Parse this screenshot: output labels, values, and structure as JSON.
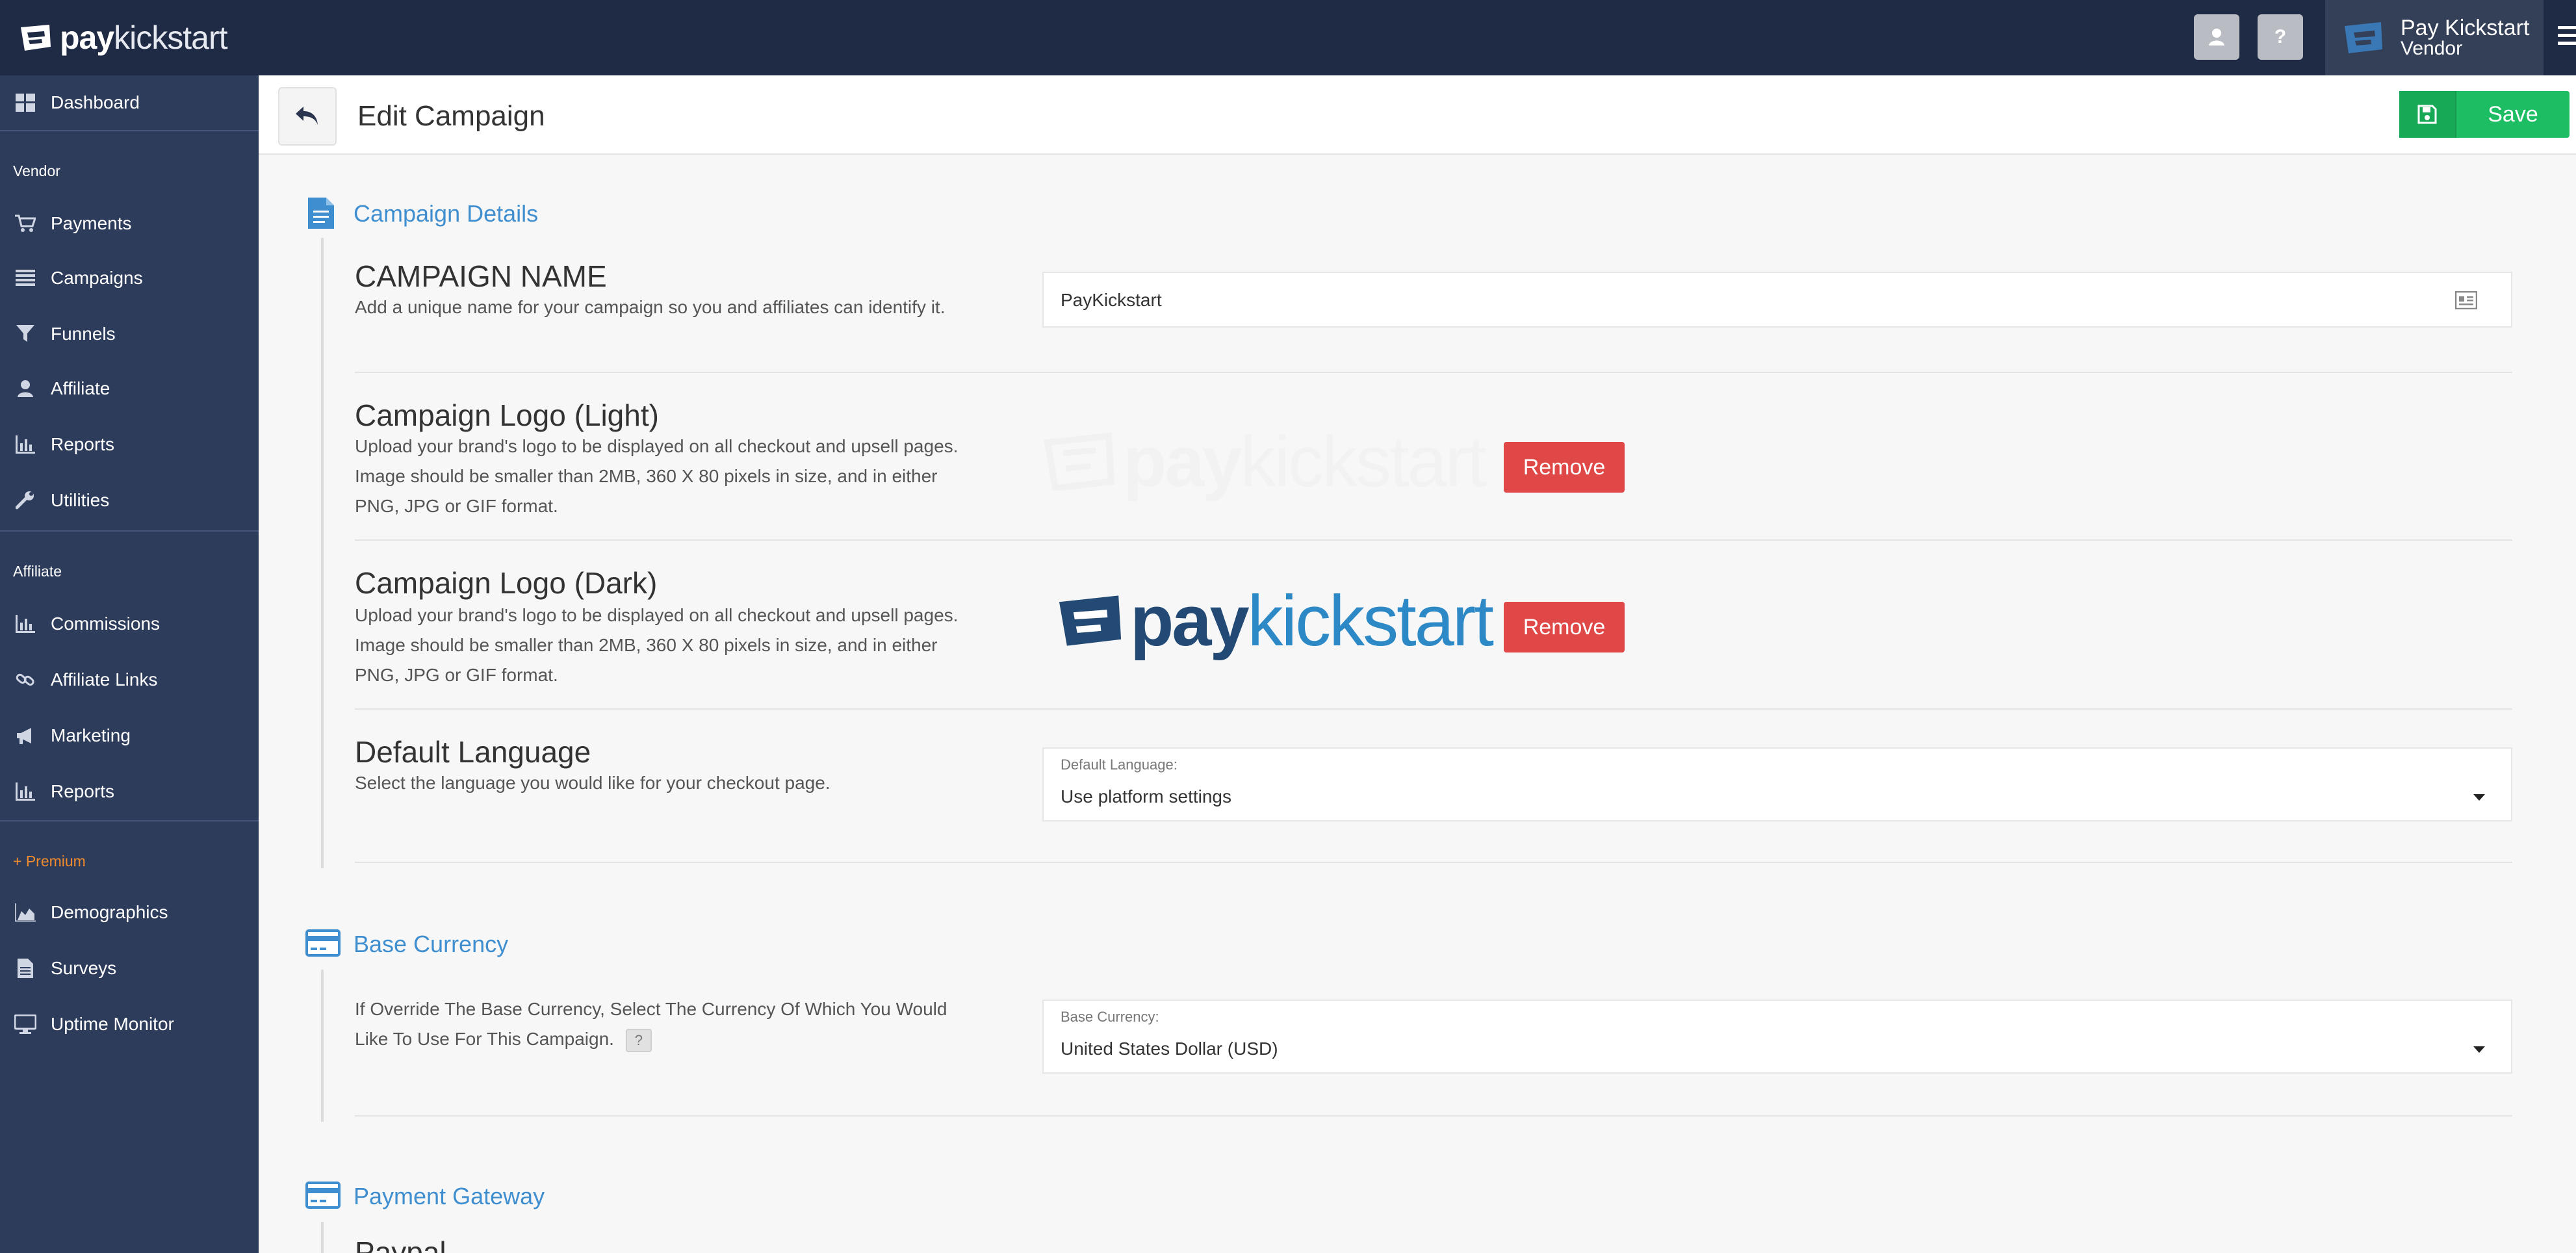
{
  "topbar": {
    "brand_bold": "pay",
    "brand_light": "kickstart",
    "user_button_label": "",
    "help_button_label": "?",
    "account_name": "Pay Kickstart",
    "account_role": "Vendor"
  },
  "sidebar": {
    "dashboard": "Dashboard",
    "vendor_heading": "Vendor",
    "vendor_items": [
      "Payments",
      "Campaigns",
      "Funnels",
      "Affiliate",
      "Reports",
      "Utilities"
    ],
    "affiliate_heading": "Affiliate",
    "affiliate_items": [
      "Commissions",
      "Affiliate Links",
      "Marketing",
      "Reports"
    ],
    "premium_heading": "+ Premium",
    "premium_items": [
      "Demographics",
      "Surveys",
      "Uptime Monitor"
    ]
  },
  "header": {
    "title": "Edit Campaign",
    "save_label": "Save"
  },
  "campaign_details": {
    "section_title": "Campaign Details",
    "name": {
      "title": "CAMPAIGN NAME",
      "description": "Add a unique name for your campaign so you and affiliates can identify it.",
      "value": "PayKickstart"
    },
    "logo_light": {
      "title": "Campaign Logo (Light)",
      "description": "Upload your brand's logo to be displayed on all checkout and upsell pages. Image should be smaller than 2MB, 360 X 80 pixels in size, and in either PNG, JPG or GIF format.",
      "remove_label": "Remove"
    },
    "logo_dark": {
      "title": "Campaign Logo (Dark)",
      "description": "Upload your brand's logo to be displayed on all checkout and upsell pages. Image should be smaller than 2MB, 360 X 80 pixels in size, and in either PNG, JPG or GIF format.",
      "remove_label": "Remove"
    },
    "language": {
      "title": "Default Language",
      "description": "Select the language you would like for your checkout page.",
      "field_label": "Default Language:",
      "value": "Use platform settings"
    }
  },
  "base_currency": {
    "section_title": "Base Currency",
    "description": "If Override The Base Currency, Select The Currency Of Which You Would Like To Use For This Campaign.",
    "help_label": "?",
    "field_label": "Base Currency:",
    "value": "United States Dollar (USD)"
  },
  "payment_gateway": {
    "section_title": "Payment Gateway",
    "first_row_title": "Paypal"
  },
  "colors": {
    "topbar": "#1f2a44",
    "sidebar": "#2e3c5c",
    "accent": "#3f8fd0",
    "save": "#1dbe63",
    "remove": "#e04848",
    "premium": "#f08a2c"
  }
}
